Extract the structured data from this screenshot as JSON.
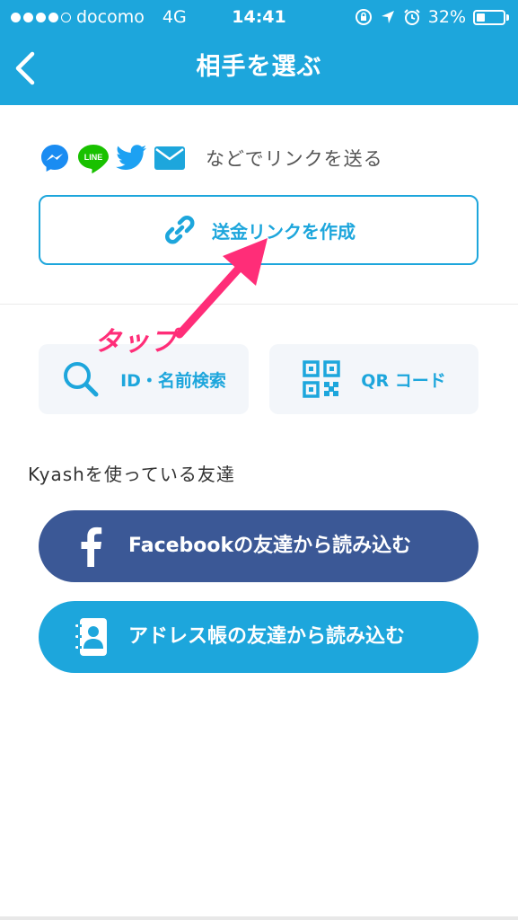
{
  "status_bar": {
    "carrier": "docomo",
    "network": "4G",
    "time": "14:41",
    "battery": "32%",
    "battery_level": 0.32,
    "signal_bars": 4
  },
  "nav": {
    "title": "相手を選ぶ",
    "back_icon": "chevron-left-icon"
  },
  "share": {
    "icons": [
      "messenger-icon",
      "line-icon",
      "twitter-icon",
      "mail-icon"
    ],
    "line_badge": "LINE",
    "text": "などでリンクを送る"
  },
  "link_button": {
    "label": "送金リンクを作成",
    "icon": "link-icon"
  },
  "annotation": {
    "text": "タップ",
    "color": "#ff2d78"
  },
  "tiles": {
    "id_search": {
      "label": "ID・名前検索",
      "icon": "search-icon"
    },
    "qr_code": {
      "label": "QR コード",
      "icon": "qr-code-icon"
    }
  },
  "friends_section": {
    "title": "Kyashを使っている友達"
  },
  "buttons": {
    "facebook": {
      "label": "Facebookの友達から読み込む",
      "icon": "facebook-icon",
      "color": "#3b5896"
    },
    "address_book": {
      "label": "アドレス帳の友達から読み込む",
      "icon": "address-book-icon",
      "color": "#1da6dc"
    }
  },
  "colors": {
    "accent": "#1da6dc",
    "tile_bg": "#f3f6fa"
  }
}
